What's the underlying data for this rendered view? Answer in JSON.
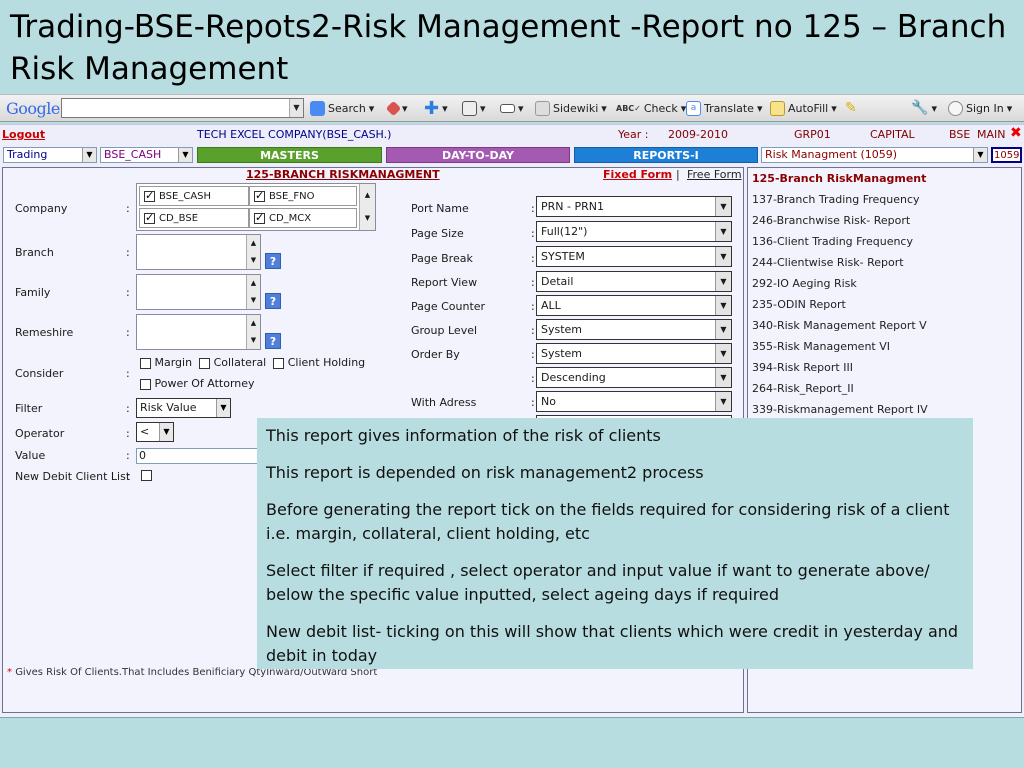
{
  "slide": {
    "title": "Trading-BSE-Repots2-Risk Management -Report no 125 – Branch Risk Management"
  },
  "google_toolbar": {
    "logo": "Google",
    "search_value": "",
    "search_label": "Search",
    "sidewiki": "Sidewiki",
    "check": "Check",
    "translate": "Translate",
    "autofill": "AutoFill",
    "signin": "Sign In"
  },
  "header": {
    "logout": "Logout",
    "company": "TECH EXCEL COMPANY(BSE_CASH.)",
    "year_label": "Year :",
    "year_value": "2009-2010",
    "grp": "GRP01",
    "capital": "CAPITAL",
    "bse": "BSE",
    "main": "MAIN",
    "close": "✖"
  },
  "menu": {
    "module": "Trading",
    "segment": "BSE_CASH",
    "masters": "MASTERS",
    "daytoday": "DAY-TO-DAY",
    "reports": "REPORTS-I",
    "report_select": "Risk Managment (1059)",
    "report_code": "1059"
  },
  "form": {
    "title": "125-BRANCH RISKMANAGMENT",
    "fixed_form": "Fixed Form",
    "separator": "|",
    "free_form": "Free Form",
    "colon": ":",
    "company_label": "Company",
    "companies": [
      "BSE_CASH",
      "BSE_FNO",
      "CD_BSE",
      "CD_MCX"
    ],
    "branch_label": "Branch",
    "family_label": "Family",
    "remeshire_label": "Remeshire",
    "consider_label": "Consider",
    "consider_opts": [
      "Margin",
      "Collateral",
      "Client Holding",
      "Power Of Attorney"
    ],
    "filter_label": "Filter",
    "filter_value": "Risk Value",
    "operator_label": "Operator",
    "operator_value": "<",
    "value_label": "Value",
    "value_value": "0",
    "newdebit_label": "New Debit Client List",
    "qm": "?",
    "port_name_label": "Port Name",
    "port_name": "PRN - PRN1",
    "page_size_label": "Page Size",
    "page_size": "Full(12\")",
    "page_break_label": "Page Break",
    "page_break": "SYSTEM",
    "report_view_label": "Report View",
    "report_view": "Detail",
    "page_counter_label": "Page Counter",
    "page_counter": "ALL",
    "group_level_label": "Group Level",
    "group_level": "System",
    "order_by_label": "Order By",
    "order_by": "System",
    "order_dir": "Descending",
    "with_adress_label": "With Adress",
    "with_adress": "No",
    "footnote_star": "*",
    "footnote": "Gives Risk Of Clients.That Includes Benificiary QtyInward/OutWard Short"
  },
  "report_list": [
    "125-Branch RiskManagment",
    "137-Branch Trading Frequency",
    "246-Branchwise Risk- Report",
    "136-Client Trading Frequency",
    "244-Clientwise Risk- Report",
    "292-IO Aeging Risk",
    "235-ODIN Report",
    "340-Risk Management Report V",
    "355-Risk Management VI",
    "394-Risk Report III",
    "264-Risk_Report_II",
    "339-Riskmanagement Report IV"
  ],
  "notes": [
    "This report gives information of the risk of clients",
    "This report is depended on risk management2 process",
    "Before generating the report tick on the fields required for considering risk of a client i.e. margin, collateral, client holding, etc",
    "Select filter if required , select operator and input value if want to generate above/ below the specific value inputted, select ageing days if required",
    "New debit list- ticking on this will show that clients which were credit in yesterday and debit in today"
  ]
}
